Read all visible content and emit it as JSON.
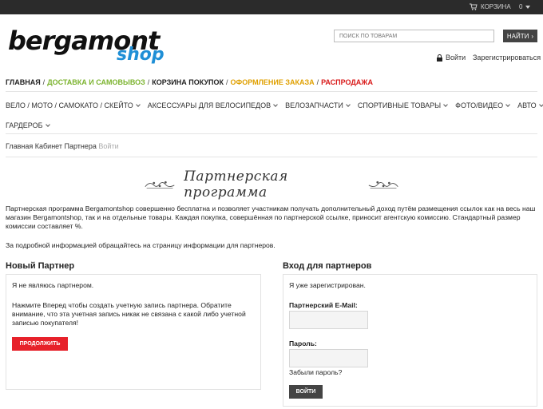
{
  "topbar": {
    "cart_label": "КОРЗИНА",
    "cart_count": "0"
  },
  "logo": {
    "line1": "bergamont",
    "line2": "shop"
  },
  "search": {
    "placeholder": "ПОИСК ПО ТОВАРАМ",
    "button_label": "НАЙТИ"
  },
  "account": {
    "login": "Войти",
    "register": "Зарегистрироваться"
  },
  "quick_nav": [
    {
      "label": "ГЛАВНАЯ",
      "color": "#222222"
    },
    {
      "label": "ДОСТАВКА И САМОВЫВОЗ",
      "color": "#7bb32e"
    },
    {
      "label": "КОРЗИНА ПОКУПОК",
      "color": "#222222"
    },
    {
      "label": "ОФОРМЛЕНИЕ ЗАКАЗА",
      "color": "#e0a000"
    },
    {
      "label": "РАСПРОДАЖА",
      "color": "#d91a1a"
    }
  ],
  "main_nav_row1": [
    "ВЕЛО / МОТО / САМОКАТО / СКЕЙТО",
    "АКСЕССУАРЫ ДЛЯ ВЕЛОСИПЕДОВ",
    "ВЕЛОЗАПЧАСТИ",
    "СПОРТИВНЫЕ ТОВАРЫ",
    "ФОТО/ВИДЕО",
    "АВТО"
  ],
  "main_nav_row2": [
    "ГАРДЕРОБ"
  ],
  "breadcrumb": {
    "home": "Главная",
    "cabinet": "Кабинет Партнера",
    "current": "Войти"
  },
  "page_title": "Партнерская программа",
  "intro": "Партнерская программа Bergamontshop совершенно бесплатна и позволяет участникам получать дополнительный доход путём размещения ссылок как на весь наш магазин Bergamontshop, так и на отдельные товары. Каждая покупка, совершённая по партнерской ссылке, приносит агентскую комиссию. Стандартный размер комиссии составляет %.",
  "info_note": "За подробной информацией обращайтесь на страницу информации для партнеров.",
  "new_partner": {
    "title": "Новый Партнер",
    "line1": "Я не являюсь партнером.",
    "desc": "Нажмите Вперед чтобы создать учетную запись партнера. Обратите внимание, что эта учетная запись никак не связана с какой либо учетной записью покупателя!",
    "button": "ПРОДОЛЖИТЬ"
  },
  "login": {
    "title": "Вход для партнеров",
    "line1": "Я уже зарегистрирован.",
    "email_label": "Партнерский E-Mail:",
    "password_label": "Пароль:",
    "forgot": "Забыли пароль?",
    "button": "ВОЙТИ"
  }
}
